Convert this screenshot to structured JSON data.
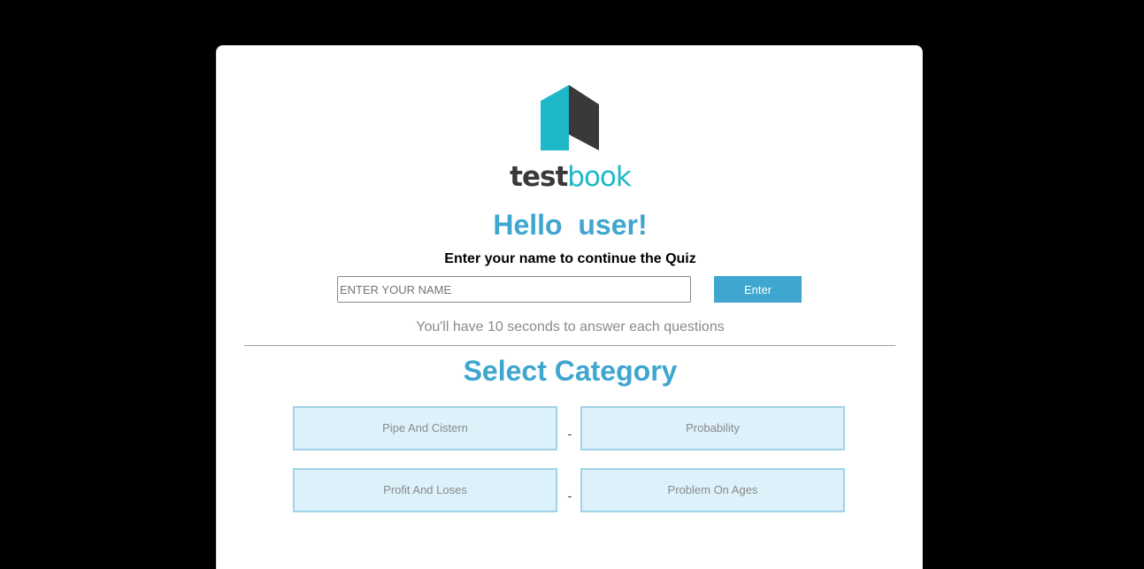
{
  "brand": {
    "name_part1": "test",
    "name_part2": "book",
    "colors": {
      "teal": "#1fb8c8",
      "dark": "#3a3838",
      "accent": "#3ea6cf"
    }
  },
  "greeting": "Hello  user!",
  "prompt": "Enter your name to continue the Quiz",
  "name_input": {
    "placeholder": "ENTER YOUR NAME",
    "value": ""
  },
  "enter_label": "Enter",
  "timer_note": "You'll have 10 seconds to answer each questions",
  "category_title": "Select Category",
  "categories": [
    {
      "label": "Pipe And Cistern"
    },
    {
      "label": "Probability"
    },
    {
      "label": "Profit And Loses"
    },
    {
      "label": "Problem On Ages"
    }
  ],
  "separator": "-"
}
